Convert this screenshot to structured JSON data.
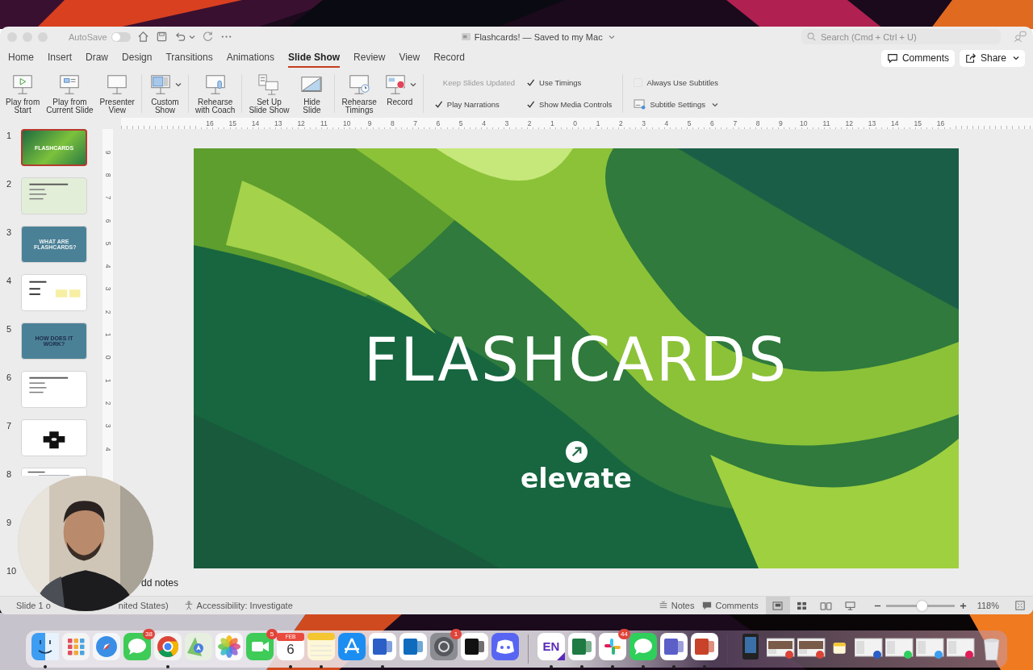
{
  "window": {
    "autosave": {
      "label": "AutoSave",
      "on": false
    },
    "title": "Flashcards! — Saved to my Mac",
    "search": {
      "placeholder": "Search (Cmd + Ctrl + U)"
    }
  },
  "tabs": [
    {
      "label": "Home",
      "selected": false
    },
    {
      "label": "Insert",
      "selected": false
    },
    {
      "label": "Draw",
      "selected": false
    },
    {
      "label": "Design",
      "selected": false
    },
    {
      "label": "Transitions",
      "selected": false
    },
    {
      "label": "Animations",
      "selected": false
    },
    {
      "label": "Slide Show",
      "selected": true
    },
    {
      "label": "Review",
      "selected": false
    },
    {
      "label": "View",
      "selected": false
    },
    {
      "label": "Record",
      "selected": false
    }
  ],
  "header_buttons": [
    {
      "kind": "comments",
      "label": "Comments"
    },
    {
      "kind": "share",
      "label": "Share"
    }
  ],
  "ribbon": {
    "groups": [
      [
        {
          "kind": "play-start",
          "label": "Play from\nStart"
        },
        {
          "kind": "play-current",
          "label": "Play from\nCurrent Slide"
        },
        {
          "kind": "presenter",
          "label": "Presenter\nView"
        }
      ],
      [
        {
          "kind": "custom",
          "label": "Custom\nShow",
          "menu": true
        }
      ],
      [
        {
          "kind": "coach",
          "label": "Rehearse\nwith Coach"
        }
      ],
      [
        {
          "kind": "setup",
          "label": "Set Up\nSlide Show"
        },
        {
          "kind": "hide",
          "label": "Hide\nSlide"
        }
      ],
      [
        {
          "kind": "timings",
          "label": "Rehearse\nTimings"
        },
        {
          "kind": "record",
          "label": "Record",
          "menu": true
        }
      ]
    ],
    "option_groups": [
      [
        [
          {
            "kind": "command",
            "label": "Keep Slides Updated",
            "disabled": true
          },
          {
            "kind": "checkbox",
            "label": "Play Narrations",
            "checked": true
          }
        ],
        [
          {
            "kind": "checkbox",
            "label": "Use Timings",
            "checked": true
          },
          {
            "kind": "checkbox",
            "label": "Show Media Controls",
            "checked": true
          }
        ]
      ],
      [
        [
          {
            "kind": "checkbox",
            "label": "Always Use Subtitles",
            "checked": false
          },
          {
            "kind": "dropdown",
            "label": "Subtitle Settings"
          }
        ]
      ]
    ]
  },
  "rulers": {
    "horizontal": [
      "16",
      "15",
      "14",
      "13",
      "12",
      "11",
      "10",
      "9",
      "8",
      "7",
      "6",
      "5",
      "4",
      "3",
      "2",
      "1",
      "0",
      "1",
      "2",
      "3",
      "4",
      "5",
      "6",
      "7",
      "8",
      "9",
      "10",
      "11",
      "12",
      "13",
      "14",
      "15",
      "16"
    ],
    "vertical": [
      "9",
      "8",
      "7",
      "6",
      "5",
      "4",
      "3",
      "2",
      "1",
      "0",
      "1",
      "2",
      "3",
      "4"
    ]
  },
  "slides": [
    {
      "number": "1",
      "selected": true,
      "kind": "green-title",
      "title": "FLASHCARDS"
    },
    {
      "number": "2",
      "selected": false,
      "kind": "green-list"
    },
    {
      "number": "3",
      "selected": false,
      "kind": "teal-title-light",
      "title": "WHAT ARE FLASHCARDS?"
    },
    {
      "number": "4",
      "selected": false,
      "kind": "white-notes"
    },
    {
      "number": "5",
      "selected": false,
      "kind": "teal-title-dark",
      "title": "HOW DOES IT WORK?"
    },
    {
      "number": "6",
      "selected": false,
      "kind": "white-list"
    },
    {
      "number": "7",
      "selected": false,
      "kind": "white-cross"
    },
    {
      "number": "8",
      "selected": false,
      "kind": "white-dark"
    },
    {
      "number": "9"
    },
    {
      "number": "10"
    }
  ],
  "slide": {
    "title": "FLASHCARDS",
    "logo_text": "elevate"
  },
  "notes": {
    "placeholder": "dd notes"
  },
  "status_bar": {
    "left": [
      "Slide 1 o",
      "nited States)"
    ],
    "accessibility": "Accessibility: Investigate",
    "notes": "Notes",
    "comments": "Comments",
    "views": [
      {
        "kind": "normal",
        "selected": true
      },
      {
        "kind": "sorter",
        "selected": false
      },
      {
        "kind": "reading",
        "selected": false
      },
      {
        "kind": "slideshow",
        "selected": false
      }
    ],
    "zoom": {
      "level": 0.52,
      "reading": "118%"
    }
  },
  "dock": {
    "apps": [
      {
        "kind": "finder",
        "running": true
      },
      {
        "kind": "launchpad",
        "running": false
      },
      {
        "kind": "safari",
        "running": false
      },
      {
        "kind": "messages",
        "running": false,
        "badge": "38"
      },
      {
        "kind": "chrome",
        "running": true
      },
      {
        "kind": "maps",
        "running": false
      },
      {
        "kind": "photos",
        "running": false
      },
      {
        "kind": "facetime",
        "running": false,
        "badge": "5"
      },
      {
        "kind": "calendar",
        "running": true,
        "month": "FEB",
        "day": "6"
      },
      {
        "kind": "notes",
        "running": true
      },
      {
        "kind": "appstore",
        "running": false
      },
      {
        "kind": "word",
        "running": true
      },
      {
        "kind": "outlook",
        "running": false
      },
      {
        "kind": "settings",
        "running": false,
        "badge": "1"
      },
      {
        "kind": "notion",
        "running": false
      },
      {
        "kind": "discord",
        "running": false
      }
    ],
    "recent": [
      {
        "kind": "evernote",
        "running": true,
        "label": "EN"
      },
      {
        "kind": "excel",
        "running": true
      },
      {
        "kind": "slack",
        "running": true,
        "badge": "44"
      },
      {
        "kind": "whatsapp",
        "running": true
      },
      {
        "kind": "teams",
        "running": true
      },
      {
        "kind": "powerpoint",
        "running": true
      }
    ],
    "windows": [
      {
        "kind": "device"
      },
      {
        "kind": "chrome"
      },
      {
        "kind": "chrome"
      },
      {
        "kind": "notes"
      },
      {
        "kind": "word"
      },
      {
        "kind": "whatsapp"
      },
      {
        "kind": "finder"
      },
      {
        "kind": "slack"
      }
    ]
  }
}
